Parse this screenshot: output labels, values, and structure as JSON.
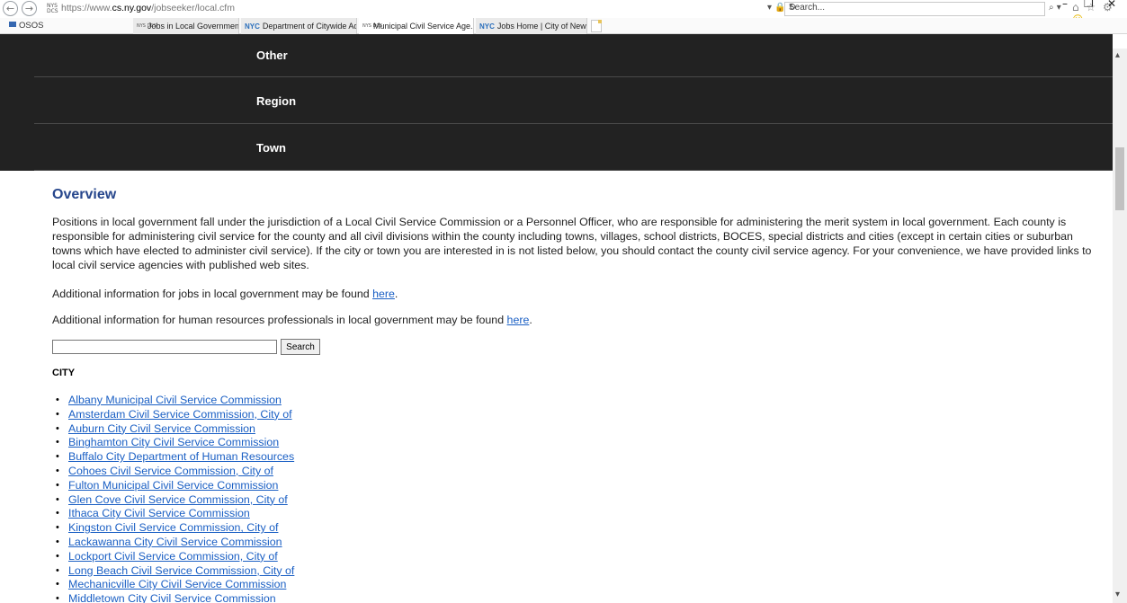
{
  "browser": {
    "url_prefix": "https://www.",
    "url_domain": "cs.ny.gov",
    "url_path": "/jobseeker/local.cfm",
    "address_controls": "▾ 🔒 ↻",
    "favicon_text": "NYS DCS",
    "search_placeholder": "Search...",
    "search_icon": "⌕ ▾",
    "toolbar_icons": "⌂ ☆ ⚙",
    "smiley": "☺",
    "window_minimize": "–",
    "window_restore": "❐",
    "window_close": "✕"
  },
  "favorites": {
    "osos_label": "OSOS"
  },
  "tabs": [
    {
      "label": "Jobs in Local Government",
      "favicon": "NYS DCS"
    },
    {
      "label": "Department of Citywide Admi...",
      "favicon": "NYC"
    },
    {
      "label": "Municipal Civil Service Age...",
      "favicon": "NYS DCS",
      "close": "✕"
    },
    {
      "label": "Jobs Home | City of New York",
      "favicon": "NYC"
    }
  ],
  "nav": {
    "items": [
      "Other",
      "Region",
      "Town"
    ]
  },
  "overview": {
    "title": "Overview",
    "paragraph": "Positions in local government fall under the jurisdiction of a Local Civil Service Commission or a Personnel Officer, who are responsible for administering the merit system in local government. Each county is responsible for administering civil service for the county and all civil divisions within the county including towns, villages, school districts, BOCES, special districts and cities (except in certain cities or suburban towns which have elected to administer civil service). If the city or town you are interested in is not listed below, you should contact the county civil service agency. For your convenience, we have provided links to local civil service agencies with published web sites.",
    "jobs_info_text": "Additional information for jobs in local government may be found ",
    "jobs_info_link": "here",
    "hr_info_text": "Additional information for human resources professionals in local government may be found ",
    "hr_info_link": "here",
    "period": "."
  },
  "search": {
    "button_label": "Search",
    "value": ""
  },
  "city": {
    "heading": "CITY",
    "items": [
      "Albany Municipal Civil Service Commission",
      "Amsterdam Civil Service Commission, City of",
      "Auburn City Civil Service Commission",
      "Binghamton City Civil Service Commission",
      "Buffalo City Department of Human Resources",
      "Cohoes Civil Service Commission, City of",
      "Fulton Municipal Civil Service Commission",
      "Glen Cove Civil Service Commission, City of",
      "Ithaca City Civil Service Commission",
      "Kingston Civil Service Commission, City of",
      "Lackawanna City Civil Service Commission",
      "Lockport Civil Service Commission, City of",
      "Long Beach Civil Service Commission, City of",
      "Mechanicville City Civil Service Commission",
      "Middletown City Civil Service Commission"
    ]
  },
  "scrollbar": {
    "up_arrow": "▴",
    "down_arrow": "▾"
  }
}
